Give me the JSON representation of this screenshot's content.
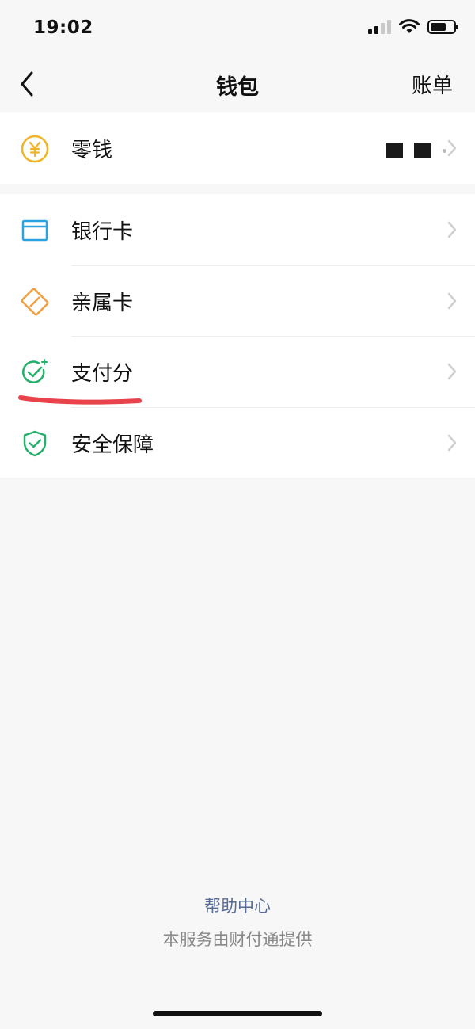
{
  "status_bar": {
    "time": "19:02"
  },
  "nav": {
    "title": "钱包",
    "right_action": "账单",
    "back_icon": "chevron-left-icon"
  },
  "change": {
    "label": "零钱",
    "icon": "yuan-coin-icon",
    "icon_color": "#f0b429"
  },
  "list": {
    "items": [
      {
        "label": "银行卡",
        "icon": "bank-card-icon",
        "color": "#2aa3e0"
      },
      {
        "label": "亲属卡",
        "icon": "family-card-icon",
        "color": "#f0a040"
      },
      {
        "label": "支付分",
        "icon": "pay-score-icon",
        "color": "#23b06b"
      },
      {
        "label": "安全保障",
        "icon": "shield-check-icon",
        "color": "#23b06b"
      }
    ]
  },
  "footer": {
    "help": "帮助中心",
    "provider": "本服务由财付通提供"
  },
  "colors": {
    "background": "#f7f7f7",
    "link": "#576b95",
    "annotation": "#e8424a"
  }
}
